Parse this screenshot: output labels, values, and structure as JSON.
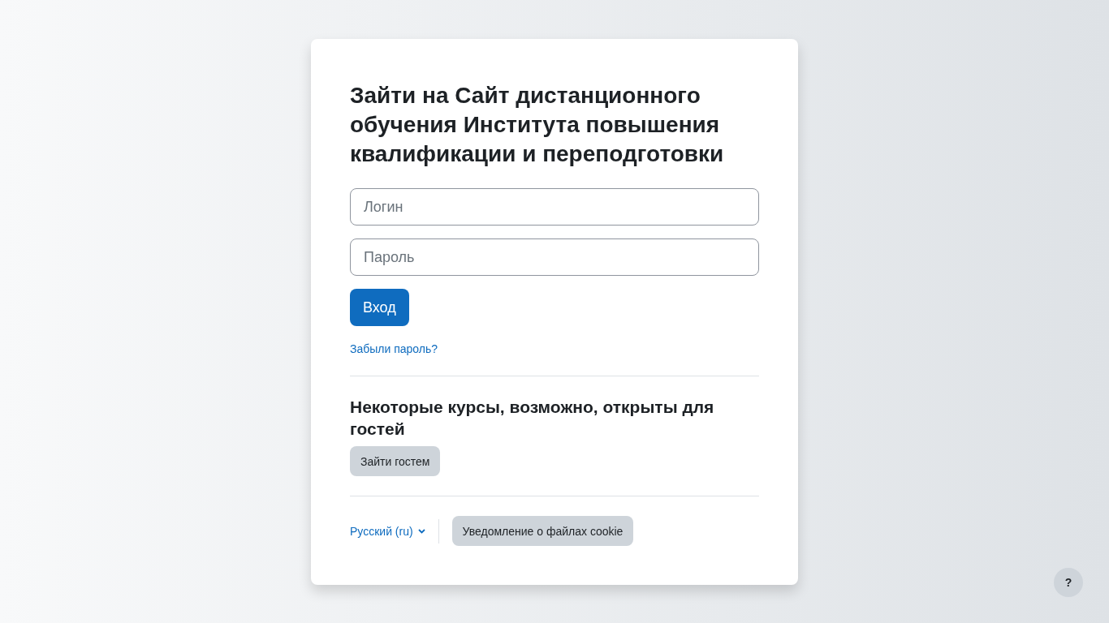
{
  "title": "Зайти на Сайт дистанционного обучения Института повышения квалификации и переподготовки",
  "login_form": {
    "username": {
      "placeholder": "Логин"
    },
    "password": {
      "placeholder": "Пароль"
    },
    "submit": "Вход",
    "forgot_link": "Забыли пароль?"
  },
  "guest": {
    "heading": "Некоторые курсы, возможно, открыты для гостей",
    "button": "Зайти гостем"
  },
  "footer": {
    "language": "Русский (ru)",
    "cookie_button": "Уведомление о файлах cookie"
  },
  "help_button": "?"
}
